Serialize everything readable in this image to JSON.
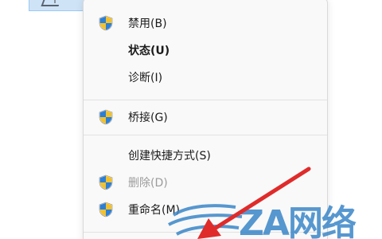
{
  "menu": {
    "items": [
      {
        "label": "禁用(B)",
        "icon": "uac-shield-icon",
        "bold": false,
        "disabled": false
      },
      {
        "label": "状态(U)",
        "icon": null,
        "bold": true,
        "disabled": false
      },
      {
        "label": "诊断(I)",
        "icon": null,
        "bold": false,
        "disabled": false
      },
      {
        "label": "桥接(G)",
        "icon": "uac-shield-icon",
        "bold": false,
        "disabled": false
      },
      {
        "label": "创建快捷方式(S)",
        "icon": null,
        "bold": false,
        "disabled": false
      },
      {
        "label": "删除(D)",
        "icon": "uac-shield-icon",
        "bold": false,
        "disabled": true
      },
      {
        "label": "重命名(M)",
        "icon": "uac-shield-icon",
        "bold": false,
        "disabled": false
      }
    ]
  },
  "watermark": {
    "text": "ZA网络",
    "color": "#3a86c8"
  },
  "colors": {
    "arrow": "#e02b2b",
    "menu_bg": "#f9f9f9",
    "disabled_text": "#9c9c9c"
  }
}
